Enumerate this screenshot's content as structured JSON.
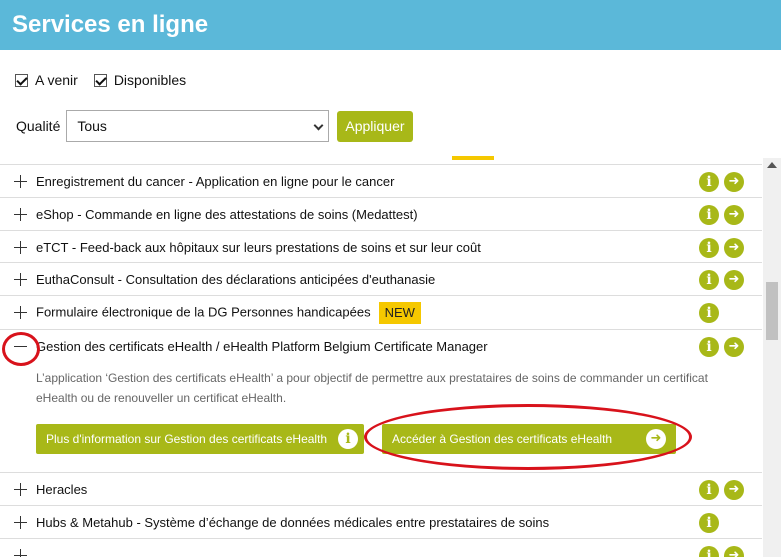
{
  "header": {
    "title": "Services en ligne"
  },
  "filters": {
    "upcoming_label": "A venir",
    "available_label": "Disponibles"
  },
  "quality": {
    "label": "Qualité",
    "selected": "Tous",
    "apply_label": "Appliquer"
  },
  "services": [
    {
      "title": "Enregistrement du cancer - Application en ligne pour le cancer"
    },
    {
      "title": "eShop - Commande en ligne des attestations de soins (Medattest)"
    },
    {
      "title": "eTCT - Feed-back aux hôpitaux sur leurs prestations de soins et sur leur coût"
    },
    {
      "title": "EuthaConsult - Consultation des déclarations anticipées d'euthanasie"
    },
    {
      "title": "Formulaire électronique de la DG Personnes handicapées",
      "badge": "NEW"
    },
    {
      "title": "Gestion des certificats eHealth / eHealth Platform Belgium Certificate Manager",
      "description": "L’application ‘Gestion des certificats eHealth’ a pour objectif de permettre aux prestataires de soins de commander un certificat eHealth ou de renouveller un certificat eHealth.",
      "more_label": "Plus d'information sur Gestion des certificats eHealth",
      "access_label": "Accéder à Gestion des certificats eHealth"
    },
    {
      "title": "Heracles"
    },
    {
      "title": "Hubs & Metahub - Système d’échange de données médicales entre prestataires de soins"
    }
  ],
  "icons": {
    "info": "i",
    "arrow": "➜"
  },
  "colors": {
    "header": "#5bb8d9",
    "accent_green": "#a8b818",
    "badge_yellow": "#f5c800",
    "annotation_red": "#d8121b"
  }
}
